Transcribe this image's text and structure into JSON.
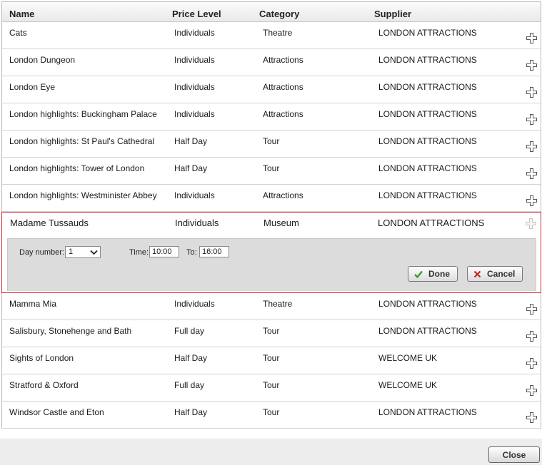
{
  "columns": {
    "name": "Name",
    "price_level": "Price Level",
    "category": "Category",
    "supplier": "Supplier"
  },
  "rows_before": [
    {
      "name": "Cats",
      "price_level": "Individuals",
      "category": "Theatre",
      "supplier": "LONDON ATTRACTIONS"
    },
    {
      "name": "London Dungeon",
      "price_level": "Individuals",
      "category": "Attractions",
      "supplier": "LONDON ATTRACTIONS"
    },
    {
      "name": "London Eye",
      "price_level": "Individuals",
      "category": "Attractions",
      "supplier": "LONDON ATTRACTIONS"
    },
    {
      "name": "London highlights: Buckingham Palace",
      "price_level": "Individuals",
      "category": "Attractions",
      "supplier": "LONDON ATTRACTIONS"
    },
    {
      "name": "London highlights: St Paul's Cathedral",
      "price_level": "Half Day",
      "category": "Tour",
      "supplier": "LONDON ATTRACTIONS"
    },
    {
      "name": "London highlights: Tower of London",
      "price_level": "Half Day",
      "category": "Tour",
      "supplier": "LONDON ATTRACTIONS"
    },
    {
      "name": "London highlights: Westminister Abbey",
      "price_level": "Individuals",
      "category": "Attractions",
      "supplier": "LONDON ATTRACTIONS"
    }
  ],
  "selected": {
    "name": "Madame Tussauds",
    "price_level": "Individuals",
    "category": "Museum",
    "supplier": "LONDON ATTRACTIONS",
    "day_label": "Day number:",
    "day_value": "1",
    "time_label": "Time:",
    "time_from": "10:00",
    "to_label": "To:",
    "time_to": "16:00",
    "done_label": "Done",
    "cancel_label": "Cancel"
  },
  "rows_after": [
    {
      "name": "Mamma Mia",
      "price_level": "Individuals",
      "category": "Theatre",
      "supplier": "LONDON ATTRACTIONS"
    },
    {
      "name": "Salisbury, Stonehenge and Bath",
      "price_level": "Full day",
      "category": "Tour",
      "supplier": "LONDON ATTRACTIONS"
    },
    {
      "name": "Sights of London",
      "price_level": "Half Day",
      "category": "Tour",
      "supplier": "WELCOME UK"
    },
    {
      "name": "Stratford & Oxford",
      "price_level": "Full day",
      "category": "Tour",
      "supplier": "WELCOME UK"
    },
    {
      "name": "Windsor Castle and Eton",
      "price_level": "Half Day",
      "category": "Tour",
      "supplier": "LONDON ATTRACTIONS"
    }
  ],
  "footer": {
    "close_label": "Close"
  },
  "colors": {
    "selected_border": "#d8292f",
    "done_check": "#3a9a2a",
    "cancel_x": "#c0282d"
  }
}
